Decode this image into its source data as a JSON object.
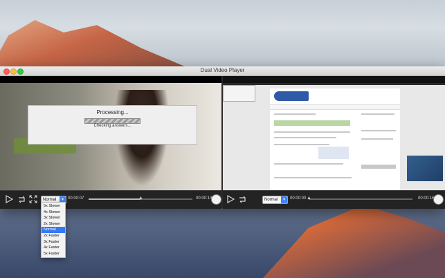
{
  "window": {
    "title": "Dual Video Player"
  },
  "left_player": {
    "dialog": {
      "title": "Processing...",
      "subtitle": "Checking answers..."
    },
    "speed_value": "Normal",
    "time_elapsed": "00:00:07",
    "time_remaining": "00:00:14",
    "progress": 0.5
  },
  "right_player": {
    "speed_value": "Normal",
    "time_elapsed": "00:00:00",
    "time_remaining": "00:00:16",
    "progress": 0.0
  },
  "speed_menu": {
    "options": [
      "5x Slower",
      "4x Slower",
      "3x Slower",
      "2x Slower",
      "Normal",
      "2x Faster",
      "3x Faster",
      "4x Faster",
      "5x Faster"
    ],
    "selected": "Normal"
  },
  "icons": {
    "play": "play-icon",
    "loop": "loop-icon",
    "fullscreen": "fullscreen-icon",
    "volume": "volume-knob-icon"
  },
  "colors": {
    "selection_blue": "#3478f6",
    "traffic_red": "#fc605c",
    "traffic_yellow": "#fdbc40",
    "traffic_green": "#34c84a"
  }
}
